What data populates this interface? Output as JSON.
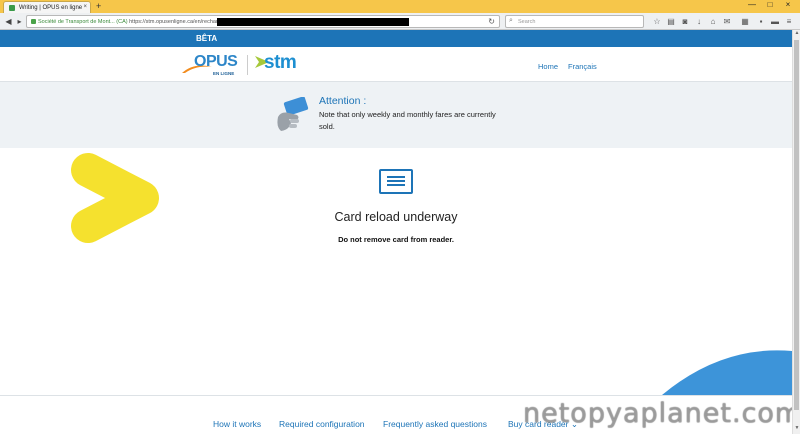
{
  "browser": {
    "tab_title": "Writing | OPUS en ligne",
    "tab_close": "×",
    "new_tab": "+",
    "url_org": "Société de Transport de Mont... (CA)",
    "url": "https://stm.opusenligne.ca/en/recharge/",
    "search_placeholder": "Search",
    "window_controls": [
      "—",
      "□",
      "×"
    ]
  },
  "beta_label": "BÊTA",
  "logos": {
    "opus_text": "OPUS",
    "opus_subtext": "EN LIGNE",
    "stm_text": "stm"
  },
  "header_nav": [
    "Home",
    "Français"
  ],
  "attention": {
    "title": "Attention :",
    "message": "Note that only weekly and monthly fares are currently sold."
  },
  "main": {
    "title": "Card reload underway",
    "subtitle": "Do not remove card from reader."
  },
  "footer_links": [
    "How it works",
    "Required configuration",
    "Frequently asked questions",
    "Buy card reader ⌄"
  ],
  "watermark": "netopyaplanet.com",
  "colors": {
    "brand_blue": "#1d74b7",
    "yellow": "#f5e12e",
    "titlebar": "#f6c64a"
  }
}
